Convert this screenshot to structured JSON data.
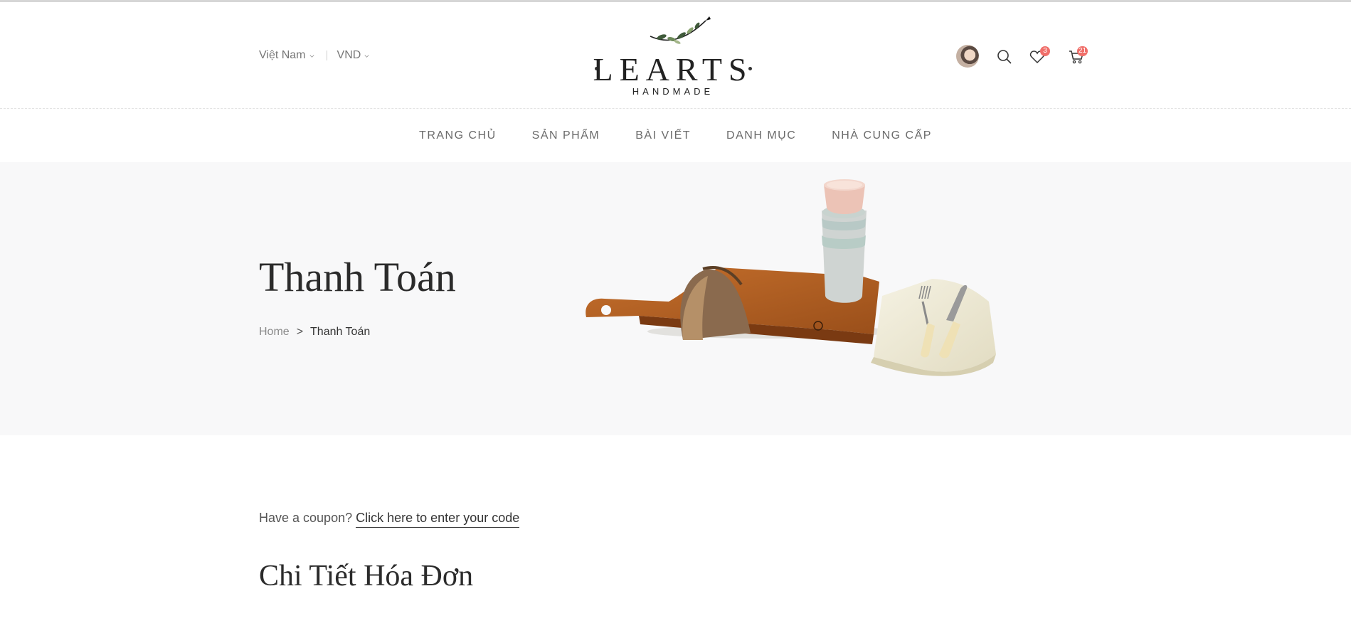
{
  "header": {
    "country": "Việt Nam",
    "currency": "VND",
    "logo": {
      "word": "LEARTS",
      "sub": "HANDMADE"
    },
    "wishlist_count": "3",
    "cart_count": "21",
    "icons": [
      "user-avatar",
      "search-icon",
      "heart-icon",
      "cart-icon",
      "chevron-down-icon"
    ]
  },
  "nav": {
    "items": [
      {
        "label": "TRANG CHỦ"
      },
      {
        "label": "SẢN PHẨM"
      },
      {
        "label": "BÀI VIẾT"
      },
      {
        "label": "DANH MỤC"
      },
      {
        "label": "NHÀ CUNG CẤP"
      }
    ]
  },
  "hero": {
    "title": "Thanh Toán",
    "breadcrumb": {
      "home": "Home",
      "separator": ">",
      "current": "Thanh Toán"
    }
  },
  "main": {
    "coupon_prefix": "Have a coupon?",
    "coupon_link": "Click here to enter your code",
    "section_title": "Chi Tiết Hóa Đơn"
  },
  "colors": {
    "badge": "#f06f6a",
    "hero_bg": "#f8f8f9",
    "text_dark": "#2b2b2b",
    "text_muted": "#777777"
  }
}
